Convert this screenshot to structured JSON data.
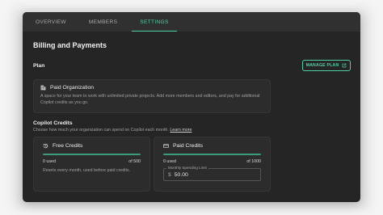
{
  "tabs": [
    {
      "label": "OVERVIEW",
      "active": false
    },
    {
      "label": "MEMBERS",
      "active": false
    },
    {
      "label": "SETTINGS",
      "active": true
    }
  ],
  "billing": {
    "title": "Billing and Payments",
    "plan_label": "Plan",
    "manage_plan_label": "MANAGE PLAN",
    "plan_card": {
      "icon": "building-icon",
      "name": "Paid Organization",
      "description": "A space for your team to work with unlimited private projects. Add more members and editors, and pay for additional Copilot credits as you go."
    }
  },
  "credits": {
    "title": "Copilot Credits",
    "subtitle": "Choose how much your organization can spend on Copilot each month.",
    "learn_more": "Learn more",
    "free": {
      "icon": "clock-refresh-icon",
      "title": "Free Credits",
      "used": "0 used",
      "total": "of 500",
      "fraction_used": 0,
      "note": "Resets every month, used before paid credits."
    },
    "paid": {
      "icon": "credit-card-icon",
      "title": "Paid Credits",
      "used": "0 used",
      "total": "of 1000",
      "fraction_used": 0,
      "limit_label": "Monthly Spending Limit",
      "currency": "$",
      "limit_value": "50.00"
    }
  },
  "colors": {
    "accent": "#4fd0a0",
    "window_bg": "#252525",
    "tab_bar_bg": "#303030"
  }
}
